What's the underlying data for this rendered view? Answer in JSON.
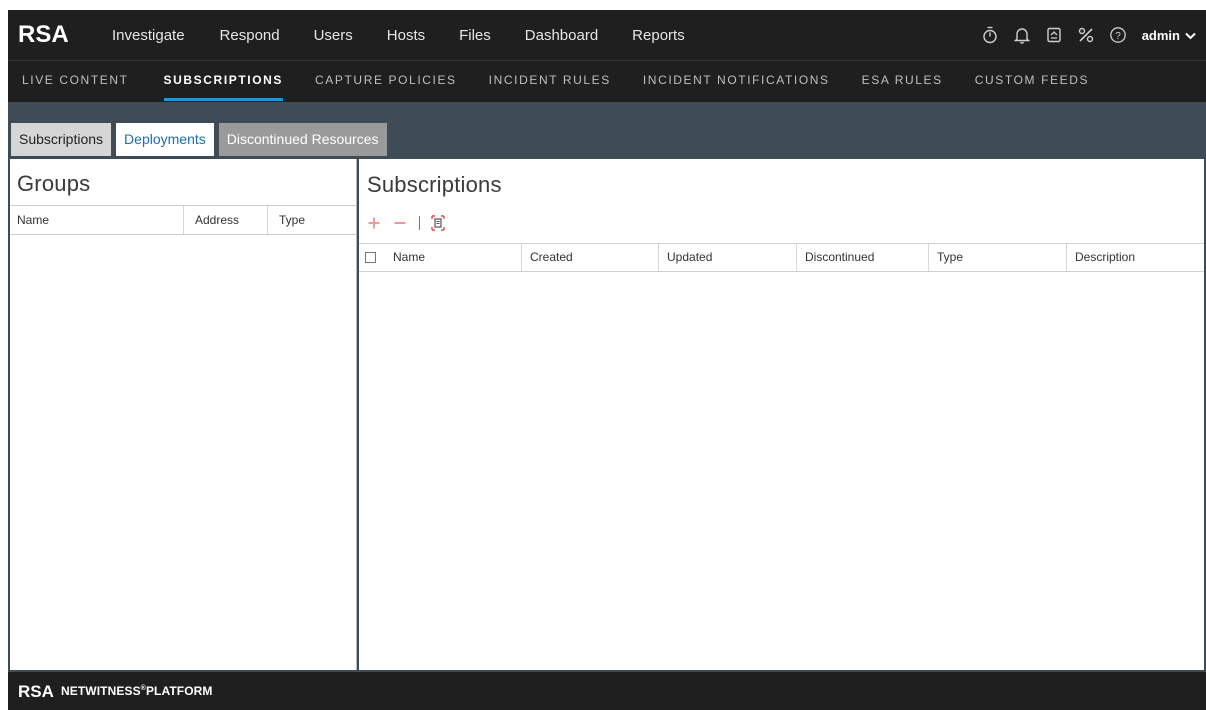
{
  "brand": {
    "logo_text": "RSA"
  },
  "topnav": {
    "items": [
      "Investigate",
      "Respond",
      "Users",
      "Hosts",
      "Files",
      "Dashboard",
      "Reports"
    ]
  },
  "topbar_icons": [
    "stopwatch-icon",
    "bell-icon",
    "clipboard-icon",
    "tools-icon",
    "help-icon"
  ],
  "user": {
    "name": "admin",
    "icon": "chevron-down-icon"
  },
  "subnav": {
    "items": [
      "LIVE CONTENT",
      "SUBSCRIPTIONS",
      "CAPTURE POLICIES",
      "INCIDENT RULES",
      "INCIDENT NOTIFICATIONS",
      "ESA RULES",
      "CUSTOM FEEDS"
    ],
    "active": "SUBSCRIPTIONS"
  },
  "tabs": {
    "items": [
      "Subscriptions",
      "Deployments",
      "Discontinued Resources"
    ],
    "active": "Deployments"
  },
  "groups_panel": {
    "title": "Groups",
    "columns": [
      "Name",
      "Address",
      "Type"
    ]
  },
  "subscriptions_panel": {
    "title": "Subscriptions",
    "toolbar_icons": [
      "add-icon",
      "remove-icon",
      "report-icon"
    ],
    "columns": [
      "Name",
      "Created",
      "Updated",
      "Discontinued",
      "Type",
      "Description"
    ]
  },
  "footer": {
    "logo_text": "RSA",
    "product": "NETWITNESS",
    "trademark": "®",
    "suffix": "PLATFORM"
  },
  "colors": {
    "nav_bg": "#1f1f1f",
    "panel_bg": "#3f4b55",
    "accent": "#1a9bd8",
    "active_tab_text": "#1c6fa8",
    "toolbar_icon": "#e04a4a"
  }
}
